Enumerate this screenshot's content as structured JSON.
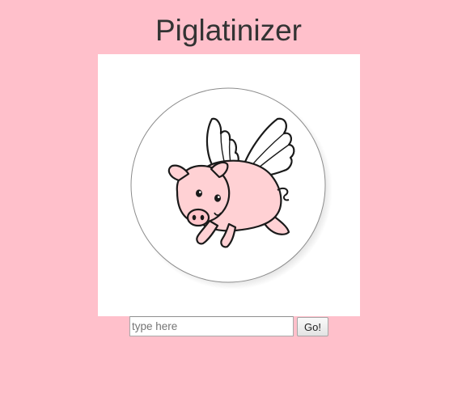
{
  "header": {
    "title": "Piglatinizer"
  },
  "image": {
    "subject": "flying-pig-sticker"
  },
  "form": {
    "input_placeholder": "type here",
    "input_value": "",
    "submit_label": "Go!"
  },
  "colors": {
    "background": "#ffc0cb",
    "title_text": "#333333",
    "pig_body": "#ffd1d4",
    "outline": "#1a1a1a"
  }
}
